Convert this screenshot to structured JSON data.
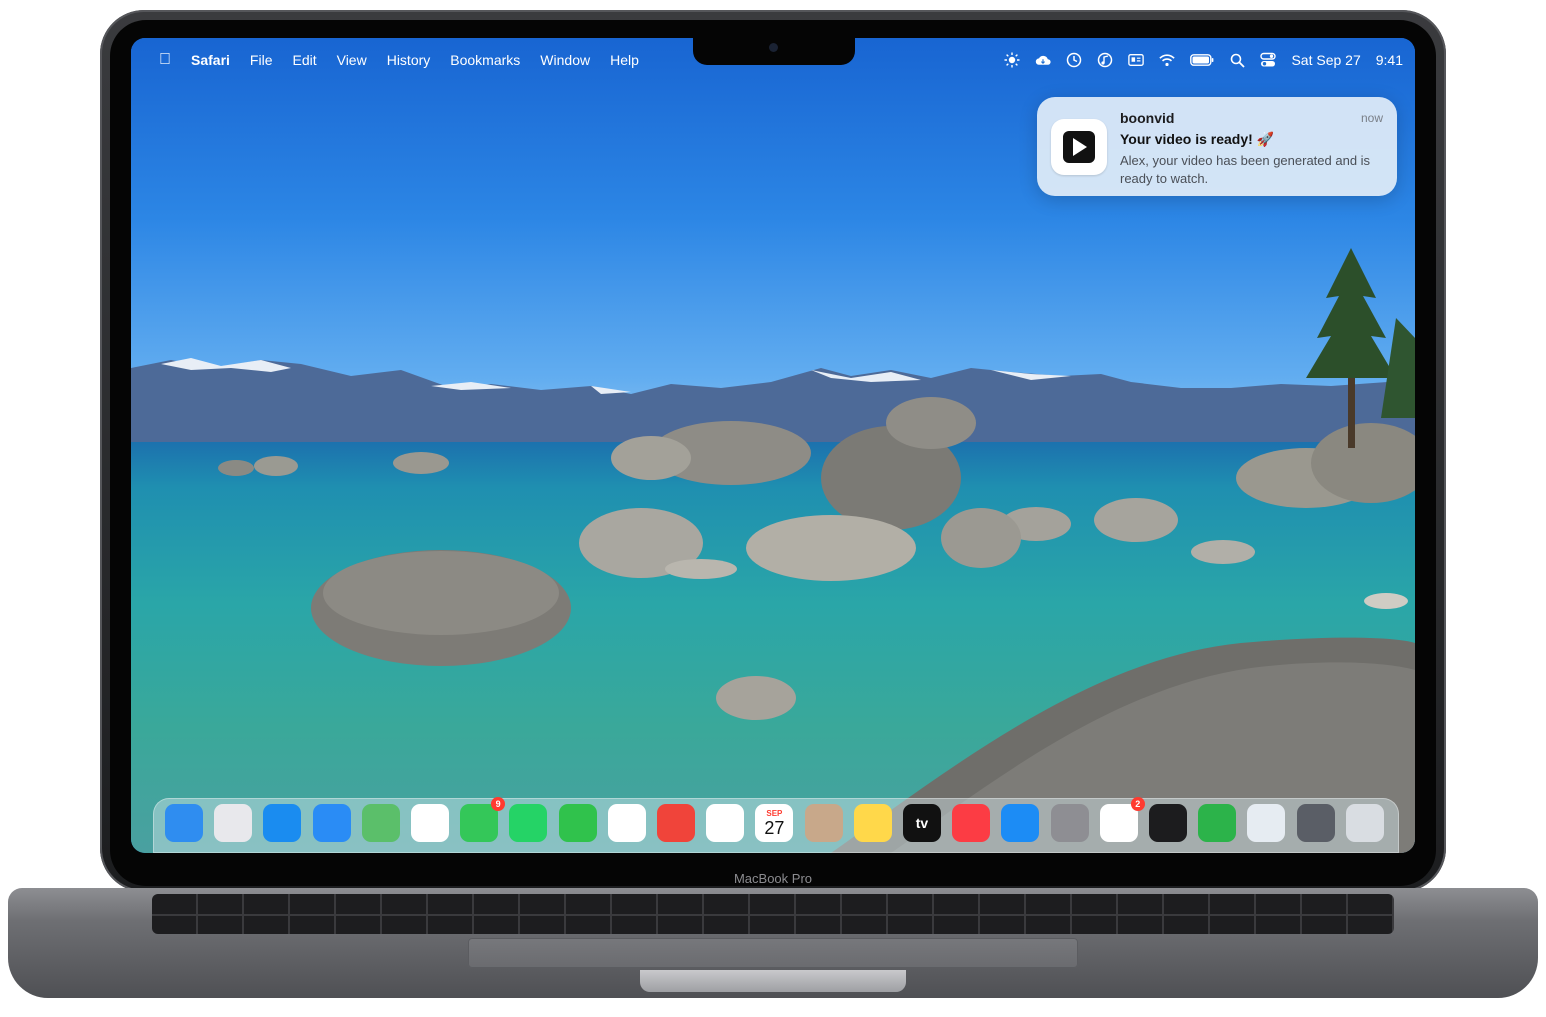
{
  "device": {
    "label": "MacBook Pro"
  },
  "menubar": {
    "app": "Safari",
    "items": [
      "File",
      "Edit",
      "View",
      "History",
      "Bookmarks",
      "Window",
      "Help"
    ],
    "status_icons": [
      "brightness-icon",
      "cloud-sync-icon",
      "clock-icon",
      "music-icon",
      "id-card-icon",
      "wifi-icon",
      "battery-icon",
      "search-icon",
      "control-center-icon"
    ],
    "date": "Sat Sep 27",
    "time": "9:41"
  },
  "notification": {
    "app_name": "boonvid",
    "time": "now",
    "title": "Your video is ready! 🚀",
    "body": "Alex, your video has been generated and is ready to watch."
  },
  "dock": {
    "items": [
      {
        "name": "finder",
        "color": "#2f8df0"
      },
      {
        "name": "launchpad",
        "color": "#e8e8ec"
      },
      {
        "name": "safari",
        "color": "#1a8cf0"
      },
      {
        "name": "mail",
        "color": "#2a8cf5"
      },
      {
        "name": "maps",
        "color": "#5bbf6a"
      },
      {
        "name": "photos",
        "color": "#ffffff"
      },
      {
        "name": "messages",
        "color": "#34c759",
        "badge": "9"
      },
      {
        "name": "whatsapp",
        "color": "#25d366"
      },
      {
        "name": "phone",
        "color": "#30c24c"
      },
      {
        "name": "chrome",
        "color": "#ffffff"
      },
      {
        "name": "mango",
        "color": "#f0443a"
      },
      {
        "name": "chatgpt",
        "color": "#ffffff"
      },
      {
        "name": "calendar",
        "color": "#ffffff",
        "month": "SEP",
        "day": "27"
      },
      {
        "name": "contacts",
        "color": "#c8a88a"
      },
      {
        "name": "notes",
        "color": "#ffd84a"
      },
      {
        "name": "apple-tv",
        "color": "#111111",
        "label": "tv"
      },
      {
        "name": "music",
        "color": "#fc3c44"
      },
      {
        "name": "app-store",
        "color": "#1c8cf5"
      },
      {
        "name": "system-settings",
        "color": "#8e8e93"
      },
      {
        "name": "reminders",
        "color": "#ffffff",
        "badge": "2"
      },
      {
        "name": "stocks",
        "color": "#1c1c1e"
      },
      {
        "name": "numbers",
        "color": "#2cb34a"
      },
      {
        "name": "quicktime",
        "color": "#e6ecf2"
      },
      {
        "name": "screen-recorder",
        "color": "#5a5e66"
      },
      {
        "name": "trash",
        "color": "#d9dde2"
      }
    ]
  }
}
